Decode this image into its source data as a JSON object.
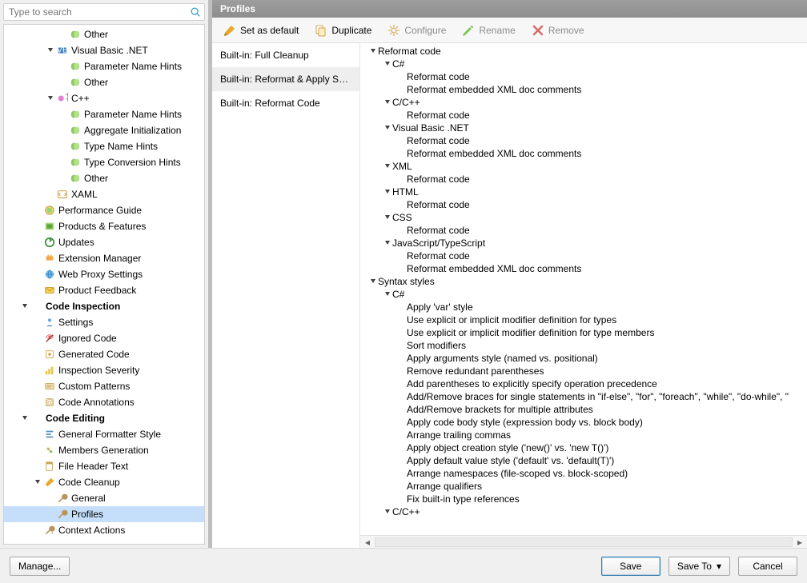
{
  "search": {
    "placeholder": "Type to search"
  },
  "left_tree": [
    {
      "indent": 4,
      "twisty": "",
      "icon": "hint",
      "label": "Other"
    },
    {
      "indent": 3,
      "twisty": "▲",
      "icon": "vb",
      "label": "Visual Basic .NET"
    },
    {
      "indent": 4,
      "twisty": "",
      "icon": "hint",
      "label": "Parameter Name Hints"
    },
    {
      "indent": 4,
      "twisty": "",
      "icon": "hint",
      "label": "Other"
    },
    {
      "indent": 3,
      "twisty": "▲",
      "icon": "cpp",
      "label": "C++"
    },
    {
      "indent": 4,
      "twisty": "",
      "icon": "hint",
      "label": "Parameter Name Hints"
    },
    {
      "indent": 4,
      "twisty": "",
      "icon": "hint",
      "label": "Aggregate Initialization"
    },
    {
      "indent": 4,
      "twisty": "",
      "icon": "hint",
      "label": "Type Name Hints"
    },
    {
      "indent": 4,
      "twisty": "",
      "icon": "hint",
      "label": "Type Conversion Hints"
    },
    {
      "indent": 4,
      "twisty": "",
      "icon": "hint",
      "label": "Other"
    },
    {
      "indent": 3,
      "twisty": "",
      "icon": "xaml",
      "label": "XAML"
    },
    {
      "indent": 2,
      "twisty": "",
      "icon": "perf",
      "label": "Performance Guide"
    },
    {
      "indent": 2,
      "twisty": "",
      "icon": "products",
      "label": "Products & Features"
    },
    {
      "indent": 2,
      "twisty": "",
      "icon": "updates",
      "label": "Updates"
    },
    {
      "indent": 2,
      "twisty": "",
      "icon": "ext",
      "label": "Extension Manager"
    },
    {
      "indent": 2,
      "twisty": "",
      "icon": "proxy",
      "label": "Web Proxy Settings"
    },
    {
      "indent": 2,
      "twisty": "",
      "icon": "feedback",
      "label": "Product Feedback"
    },
    {
      "indent": 1,
      "twisty": "▲",
      "icon": "",
      "label": "Code Inspection",
      "bold": true
    },
    {
      "indent": 2,
      "twisty": "",
      "icon": "settings",
      "label": "Settings"
    },
    {
      "indent": 2,
      "twisty": "",
      "icon": "ignored",
      "label": "Ignored Code"
    },
    {
      "indent": 2,
      "twisty": "",
      "icon": "generated",
      "label": "Generated Code"
    },
    {
      "indent": 2,
      "twisty": "",
      "icon": "severity",
      "label": "Inspection Severity"
    },
    {
      "indent": 2,
      "twisty": "",
      "icon": "patterns",
      "label": "Custom Patterns"
    },
    {
      "indent": 2,
      "twisty": "",
      "icon": "annotations",
      "label": "Code Annotations"
    },
    {
      "indent": 1,
      "twisty": "▲",
      "icon": "",
      "label": "Code Editing",
      "bold": true
    },
    {
      "indent": 2,
      "twisty": "",
      "icon": "formatter",
      "label": "General Formatter Style"
    },
    {
      "indent": 2,
      "twisty": "",
      "icon": "members",
      "label": "Members Generation"
    },
    {
      "indent": 2,
      "twisty": "",
      "icon": "fileheader",
      "label": "File Header Text"
    },
    {
      "indent": 2,
      "twisty": "▲",
      "icon": "cleanup",
      "label": "Code Cleanup"
    },
    {
      "indent": 3,
      "twisty": "",
      "icon": "wrench",
      "label": "General"
    },
    {
      "indent": 3,
      "twisty": "",
      "icon": "wrench",
      "label": "Profiles",
      "selected": true
    },
    {
      "indent": 2,
      "twisty": "",
      "icon": "context",
      "label": "Context Actions"
    }
  ],
  "header": {
    "title": "Profiles"
  },
  "toolbar": {
    "set_default": "Set as default",
    "duplicate": "Duplicate",
    "configure": "Configure",
    "rename": "Rename",
    "remove": "Remove"
  },
  "profiles": [
    {
      "label": "Built-in: Full Cleanup"
    },
    {
      "label": "Built-in: Reformat & Apply Syn...",
      "selected": true
    },
    {
      "label": "Built-in: Reformat Code"
    }
  ],
  "details": [
    {
      "indent": 0,
      "twisty": "▲",
      "label": "Reformat code"
    },
    {
      "indent": 1,
      "twisty": "▲",
      "label": "C#"
    },
    {
      "indent": 2,
      "twisty": "",
      "label": "Reformat code"
    },
    {
      "indent": 2,
      "twisty": "",
      "label": "Reformat embedded XML doc comments"
    },
    {
      "indent": 1,
      "twisty": "▲",
      "label": "C/C++"
    },
    {
      "indent": 2,
      "twisty": "",
      "label": "Reformat code"
    },
    {
      "indent": 1,
      "twisty": "▲",
      "label": "Visual Basic .NET"
    },
    {
      "indent": 2,
      "twisty": "",
      "label": "Reformat code"
    },
    {
      "indent": 2,
      "twisty": "",
      "label": "Reformat embedded XML doc comments"
    },
    {
      "indent": 1,
      "twisty": "▲",
      "label": "XML"
    },
    {
      "indent": 2,
      "twisty": "",
      "label": "Reformat code"
    },
    {
      "indent": 1,
      "twisty": "▲",
      "label": "HTML"
    },
    {
      "indent": 2,
      "twisty": "",
      "label": "Reformat code"
    },
    {
      "indent": 1,
      "twisty": "▲",
      "label": "CSS"
    },
    {
      "indent": 2,
      "twisty": "",
      "label": "Reformat code"
    },
    {
      "indent": 1,
      "twisty": "▲",
      "label": "JavaScript/TypeScript"
    },
    {
      "indent": 2,
      "twisty": "",
      "label": "Reformat code"
    },
    {
      "indent": 2,
      "twisty": "",
      "label": "Reformat embedded XML doc comments"
    },
    {
      "indent": 0,
      "twisty": "▲",
      "label": "Syntax styles"
    },
    {
      "indent": 1,
      "twisty": "▲",
      "label": "C#"
    },
    {
      "indent": 2,
      "twisty": "",
      "label": "Apply 'var' style"
    },
    {
      "indent": 2,
      "twisty": "",
      "label": "Use explicit or implicit modifier definition for types"
    },
    {
      "indent": 2,
      "twisty": "",
      "label": "Use explicit or implicit modifier definition for type members"
    },
    {
      "indent": 2,
      "twisty": "",
      "label": "Sort modifiers"
    },
    {
      "indent": 2,
      "twisty": "",
      "label": "Apply arguments style (named vs. positional)"
    },
    {
      "indent": 2,
      "twisty": "",
      "label": "Remove redundant parentheses"
    },
    {
      "indent": 2,
      "twisty": "",
      "label": "Add parentheses to explicitly specify operation precedence"
    },
    {
      "indent": 2,
      "twisty": "",
      "label": "Add/Remove braces for single statements in \"if-else\", \"for\", \"foreach\", \"while\", \"do-while\", \""
    },
    {
      "indent": 2,
      "twisty": "",
      "label": "Add/Remove brackets for multiple attributes"
    },
    {
      "indent": 2,
      "twisty": "",
      "label": "Apply code body style (expression body vs. block body)"
    },
    {
      "indent": 2,
      "twisty": "",
      "label": "Arrange trailing commas"
    },
    {
      "indent": 2,
      "twisty": "",
      "label": "Apply object creation style ('new()' vs. 'new T()')"
    },
    {
      "indent": 2,
      "twisty": "",
      "label": "Apply default value style ('default' vs. 'default(T)')"
    },
    {
      "indent": 2,
      "twisty": "",
      "label": "Arrange namespaces (file-scoped vs. block-scoped)"
    },
    {
      "indent": 2,
      "twisty": "",
      "label": "Arrange qualifiers"
    },
    {
      "indent": 2,
      "twisty": "",
      "label": "Fix built-in type references"
    },
    {
      "indent": 1,
      "twisty": "▲",
      "label": "C/C++"
    }
  ],
  "footer": {
    "manage": "Manage...",
    "save": "Save",
    "save_to": "Save To",
    "cancel": "Cancel"
  }
}
